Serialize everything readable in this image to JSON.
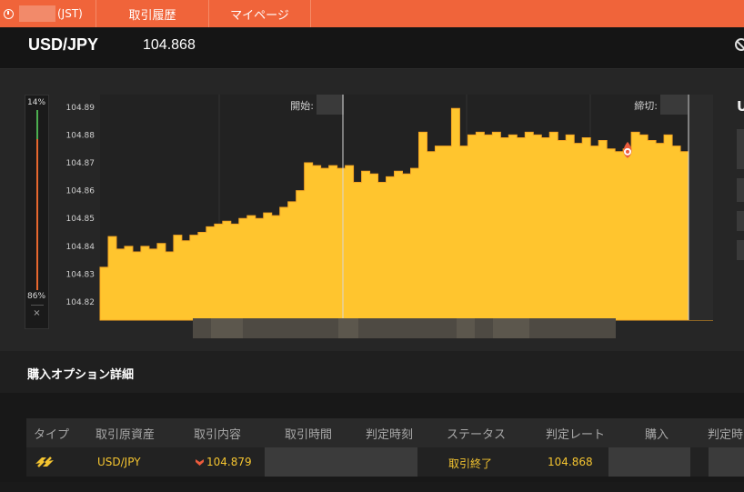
{
  "nav": {
    "clock_suffix": "(JST)",
    "tabs": [
      "取引履歴",
      "マイページ"
    ]
  },
  "pair": {
    "symbol": "USD/JPY",
    "price": "104.868"
  },
  "ratio": {
    "top_pct": "14%",
    "bottom_pct": "86%",
    "close": "×"
  },
  "chart_data": {
    "type": "area",
    "y_ticks": [
      "104.89",
      "104.88",
      "104.87",
      "104.86",
      "104.85",
      "104.84",
      "104.83",
      "104.82"
    ],
    "ylim": [
      104.8135,
      104.8945
    ],
    "labels": {
      "start": "開始:",
      "end": "締切:"
    },
    "fill_color": "#ffc52e",
    "line_color": "#f5a623",
    "marker_color": "#ec5b3c",
    "values": [
      104.8325,
      104.8435,
      104.839,
      104.84,
      104.838,
      104.84,
      104.839,
      104.841,
      104.838,
      104.844,
      104.842,
      104.844,
      104.845,
      104.847,
      104.848,
      104.849,
      104.848,
      104.85,
      104.851,
      104.85,
      104.852,
      104.851,
      104.854,
      104.856,
      104.86,
      104.87,
      104.869,
      104.868,
      104.869,
      104.868,
      104.869,
      104.863,
      104.867,
      104.866,
      104.863,
      104.865,
      104.867,
      104.866,
      104.868,
      104.881,
      104.874,
      104.876,
      104.876,
      104.8895,
      104.876,
      104.88,
      104.881,
      104.88,
      104.881,
      104.879,
      104.88,
      104.879,
      104.881,
      104.88,
      104.879,
      104.881,
      104.878,
      104.88,
      104.877,
      104.879,
      104.876,
      104.878,
      104.875,
      104.874,
      104.875,
      104.881,
      104.88,
      104.878,
      104.877,
      104.88,
      104.876,
      104.874,
      104.873,
      104.872,
      104.873,
      104.868
    ],
    "marker_value": 104.873
  },
  "detail": {
    "title": "購入オプション詳細",
    "headers": [
      "タイプ",
      "取引原資産",
      "取引内容",
      "取引時間",
      "判定時刻",
      "ステータス",
      "判定レート",
      "購入",
      "判定時"
    ],
    "row": {
      "asset": "USD/JPY",
      "content": "104.879",
      "status": "取引終了",
      "rate": "104.868"
    }
  }
}
